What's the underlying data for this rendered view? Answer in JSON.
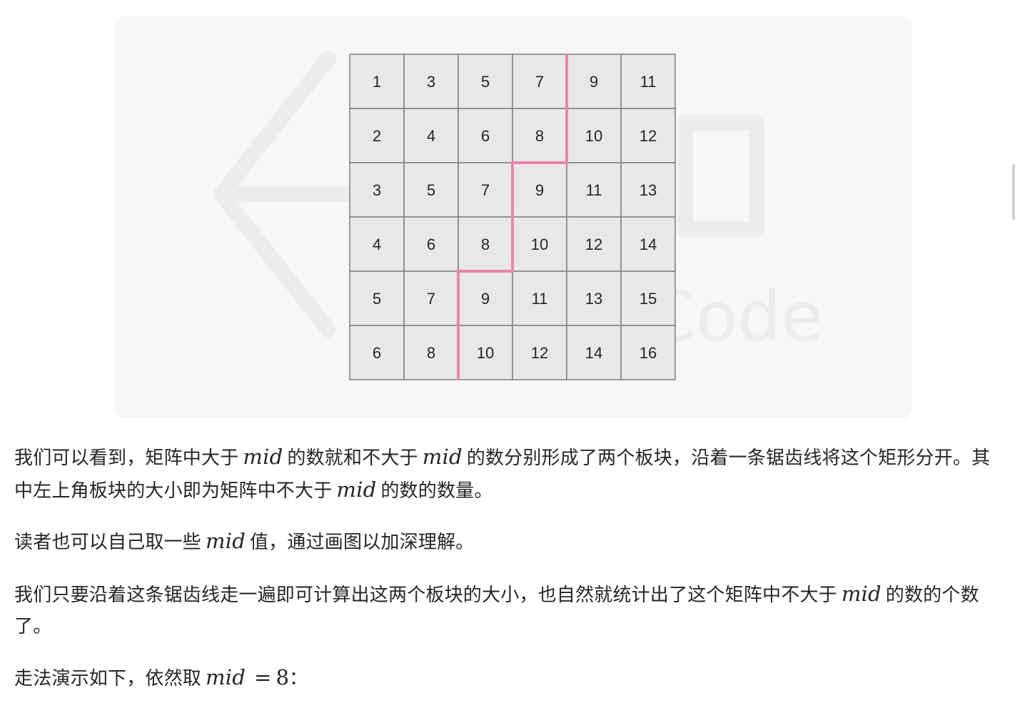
{
  "figure": {
    "matrix": [
      [
        1,
        3,
        5,
        7,
        9,
        11
      ],
      [
        2,
        4,
        6,
        8,
        10,
        12
      ],
      [
        3,
        5,
        7,
        9,
        11,
        13
      ],
      [
        4,
        6,
        8,
        10,
        12,
        14
      ],
      [
        5,
        7,
        9,
        11,
        13,
        15
      ],
      [
        6,
        8,
        10,
        12,
        14,
        16
      ]
    ],
    "boundary_columns_by_row": [
      4,
      4,
      3,
      3,
      2,
      2
    ],
    "colors": {
      "cell_fill": "#e8e8e8",
      "grid_line": "#858585",
      "cell_text": "#262626",
      "staircase_line": "#ec84ad",
      "card_bg": "#f7f7f8",
      "watermark": "#ececee"
    },
    "watermark_text": "LeetCode"
  },
  "paragraphs": {
    "p1_a": "我们可以看到，矩阵中大于",
    "p1_math1": "mid",
    "p1_b": "的数就和不大于",
    "p1_math2": "mid",
    "p1_c": "的数分别形成了两个板块，沿着一条锯齿线将这个矩形分开。其中左上角板块的大小即为矩阵中不大于",
    "p1_math3": "mid",
    "p1_d": "的数的数量。",
    "p2_a": "读者也可以自己取一些",
    "p2_math": "mid",
    "p2_b": "值，通过画图以加深理解。",
    "p3_a": "我们只要沿着这条锯齿线走一遍即可计算出这两个板块的大小，也自然就统计出了这个矩阵中不大于",
    "p3_math": "mid",
    "p3_b": "的数的个数了。",
    "p4_a": "走法演示如下，依然取",
    "p4_math_var": "mid",
    "p4_math_op": "=",
    "p4_math_val": "8",
    "p4_b": "："
  }
}
